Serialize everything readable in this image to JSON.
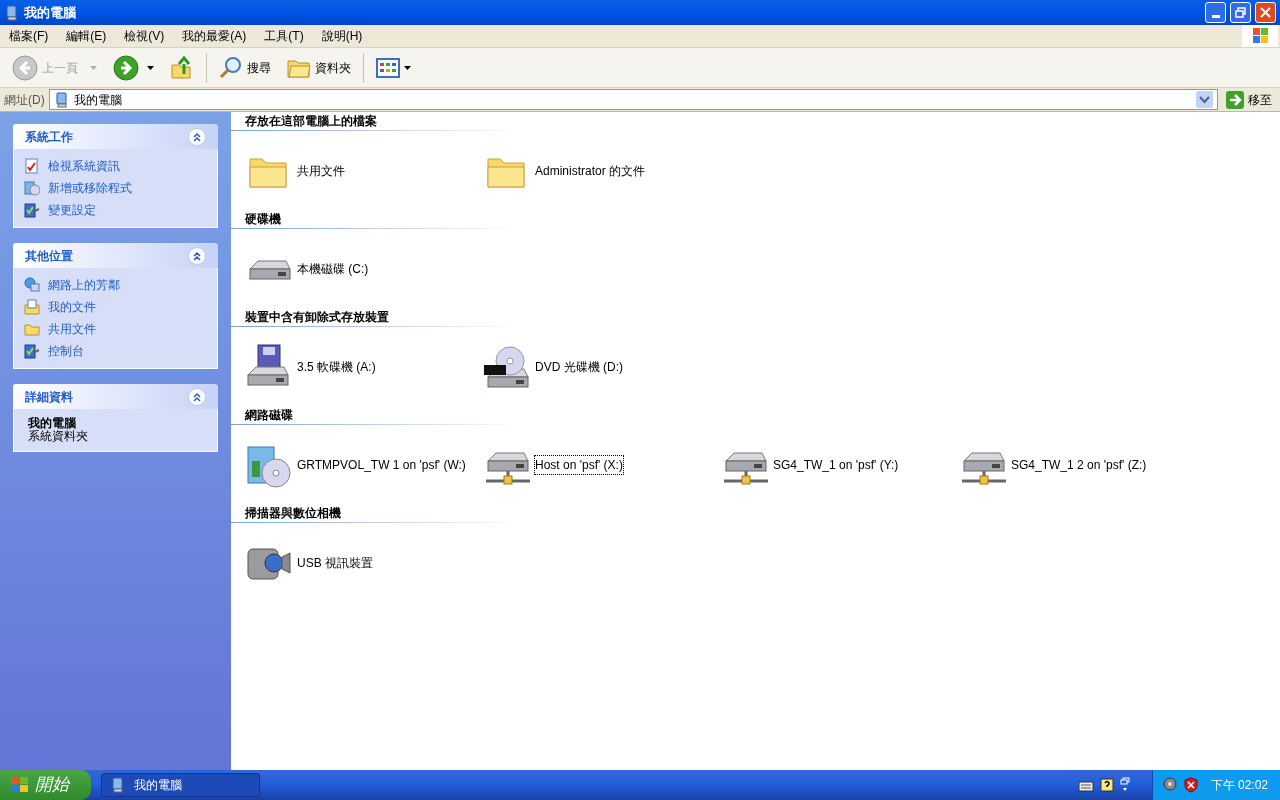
{
  "window": {
    "title": "我的電腦"
  },
  "menu": [
    "檔案(F)",
    "編輯(E)",
    "檢視(V)",
    "我的最愛(A)",
    "工具(T)",
    "說明(H)"
  ],
  "toolbar": [
    {
      "kind": "back",
      "label": "上一頁",
      "disabled": true
    },
    {
      "kind": "forward",
      "disabled": false
    },
    {
      "kind": "up",
      "disabled": false
    },
    {
      "kind": "search",
      "label": "搜尋",
      "disabled": false
    },
    {
      "kind": "folders",
      "label": "資料夾",
      "disabled": false
    },
    {
      "kind": "views",
      "disabled": false
    }
  ],
  "address": {
    "label": "網址(D)",
    "value": "我的電腦",
    "go": "移至"
  },
  "sidebar": [
    {
      "kind": "tasks",
      "title": "系統工作",
      "expanded": true,
      "items": [
        {
          "kind": "sysinfo",
          "label": "檢視系統資訊"
        },
        {
          "kind": "programs",
          "label": "新增或移除程式"
        },
        {
          "kind": "control",
          "label": "變更設定"
        }
      ]
    },
    {
      "kind": "tasks",
      "title": "其他位置",
      "expanded": true,
      "items": [
        {
          "kind": "network",
          "label": "網路上的芳鄰"
        },
        {
          "kind": "documents",
          "label": "我的文件"
        },
        {
          "kind": "folder",
          "label": "共用文件"
        },
        {
          "kind": "control",
          "label": "控制台"
        }
      ]
    },
    {
      "kind": "details",
      "title": "詳細資料",
      "expanded": true,
      "name": "我的電腦",
      "subtitle": "系統資料夾"
    }
  ],
  "sections": [
    {
      "title": "存放在這部電腦上的檔案",
      "items": [
        {
          "kind": "folder",
          "label": "共用文件",
          "selected": false
        },
        {
          "kind": "folder",
          "label": "Administrator 的文件",
          "selected": false
        }
      ]
    },
    {
      "title": "硬碟機",
      "items": [
        {
          "kind": "hdd",
          "label": "本機磁碟 (C:)",
          "selected": false
        }
      ]
    },
    {
      "title": "裝置中含有卸除式存放裝置",
      "items": [
        {
          "kind": "floppy",
          "label": "3.5 軟碟機 (A:)",
          "selected": false
        },
        {
          "kind": "dvd",
          "label": "DVD 光碟機 (D:)",
          "selected": false
        }
      ]
    },
    {
      "title": "網路磁碟",
      "items": [
        {
          "kind": "installer",
          "label": "GRTMPVOL_TW 1 on 'psf' (W:)",
          "selected": false
        },
        {
          "kind": "netdrive",
          "label": "Host on 'psf' (X:)",
          "selected": true
        },
        {
          "kind": "netdrive",
          "label": "SG4_TW_1 on 'psf' (Y:)",
          "selected": false
        },
        {
          "kind": "netdrive",
          "label": "SG4_TW_1 2 on 'psf' (Z:)",
          "selected": false
        }
      ]
    },
    {
      "title": "掃描器與數位相機",
      "items": [
        {
          "kind": "camera",
          "label": "USB 視訊裝置",
          "selected": false
        }
      ]
    }
  ],
  "taskbar": {
    "start": "開始",
    "tasks": [
      {
        "label": "我的電腦",
        "selected": true
      }
    ],
    "clock": "下午 02:02"
  }
}
